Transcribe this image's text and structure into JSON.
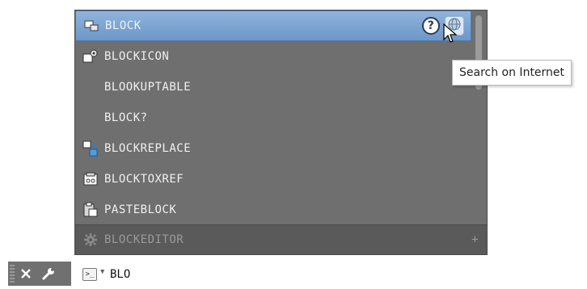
{
  "autocomplete": {
    "items": [
      {
        "label": "BLOCK",
        "icon": "block-icon",
        "selected": true
      },
      {
        "label": "BLOCKICON",
        "icon": "blockicon-icon"
      },
      {
        "label": "BLOOKUPTABLE",
        "icon": ""
      },
      {
        "label": "BLOCK?",
        "icon": ""
      },
      {
        "label": "BLOCKREPLACE",
        "icon": "block-replace-icon"
      },
      {
        "label": "BLOCKTOXREF",
        "icon": "block-to-xref-icon"
      },
      {
        "label": "PASTEBLOCK",
        "icon": "paste-block-icon"
      }
    ],
    "footer": {
      "label": "BLOCKEDITOR",
      "icon": "gear-icon",
      "plus": "+"
    },
    "help_label": "?",
    "tooltip": "Search on Internet"
  },
  "command_line": {
    "input_value": "BLO",
    "prompt_icon": "command-prompt-icon"
  },
  "colors": {
    "panel_bg": "#6f6f6f",
    "selected_bg": "#7da6d4",
    "footer_bg": "#5a5a5a",
    "text": "#f0f0f0"
  }
}
